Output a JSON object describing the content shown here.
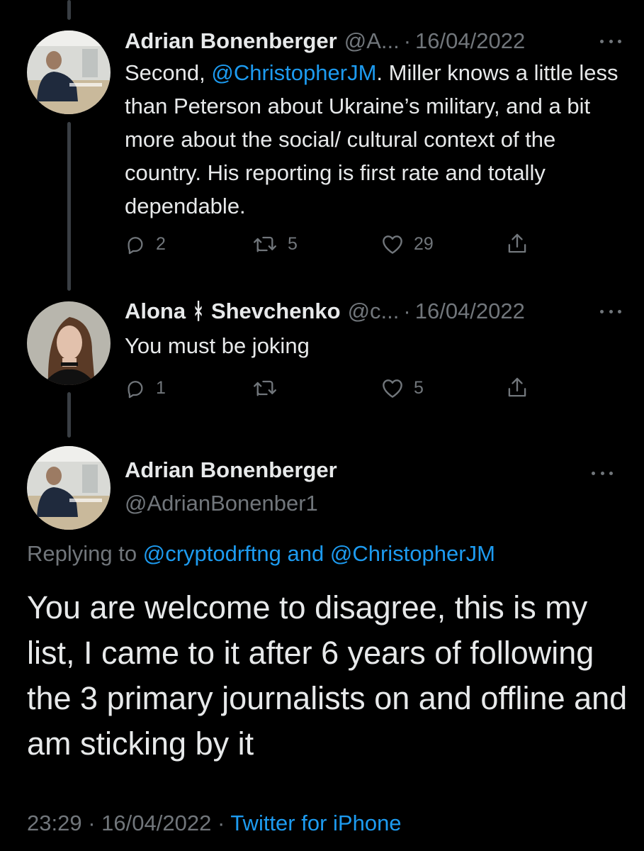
{
  "colors": {
    "background": "#000000",
    "text_primary": "#e7e9ea",
    "text_secondary": "#71767b",
    "link": "#1d9bf0",
    "thread_line": "#3a3f44"
  },
  "tweets": [
    {
      "author_name": "Adrian Bonenberger",
      "handle": "@A...",
      "separator": "·",
      "date": "16/04/2022",
      "more_icon": "more-horizontal-icon",
      "text_before_mention": "Second, ",
      "mention": "@ChristopherJM",
      "text_after_mention": ". Miller knows a little less than Peterson about Ukraine’s military, and a bit more about the social/ cultural context of the country. His reporting is first rate and totally dependable.",
      "reply_count": "2",
      "retweet_count": "5",
      "like_count": "29",
      "icons": [
        "reply-icon",
        "retweet-icon",
        "like-icon",
        "share-icon"
      ]
    },
    {
      "author_name": "Alona ᚼ Shevchenko",
      "handle": "@c...",
      "separator": "·",
      "date": "16/04/2022",
      "more_icon": "more-horizontal-icon",
      "text": "You must be joking",
      "reply_count": "1",
      "retweet_count": "",
      "like_count": "5",
      "icons": [
        "reply-icon",
        "retweet-icon",
        "like-icon",
        "share-icon"
      ]
    }
  ],
  "main_tweet": {
    "author_name": "Adrian Bonenberger",
    "handle": "@AdrianBonenber1",
    "more_icon": "more-horizontal-icon",
    "replying_prefix": "Replying to",
    "replying_mention_1": "@cryptodrftng",
    "replying_and": "and",
    "replying_mention_2": "@ChristopherJM",
    "text": "You are welcome to disagree, this is my list, I came to it after 6 years of following the 3 primary journalists on and offline and am sticking by it",
    "time": "23:29",
    "separator": "·",
    "date": "16/04/2022",
    "source": "Twitter for iPhone"
  }
}
